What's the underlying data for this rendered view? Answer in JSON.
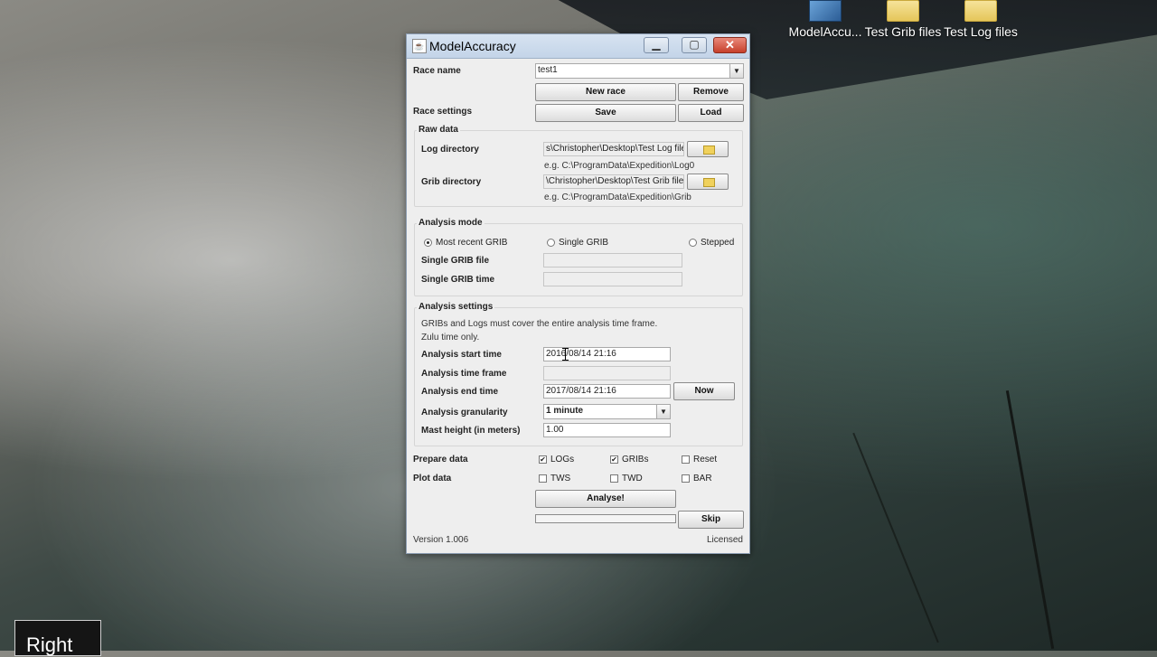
{
  "desktop": {
    "icons": [
      {
        "label": "ModelAccu...",
        "kind": "app"
      },
      {
        "label": "Test Grib files",
        "kind": "folder"
      },
      {
        "label": "Test Log files",
        "kind": "folder"
      }
    ],
    "corner_label": "Right"
  },
  "window": {
    "title": "ModelAccuracy",
    "controls": {
      "minimize": "▁",
      "maximize": "▢",
      "close": "✕"
    },
    "race": {
      "name_label": "Race name",
      "name_value": "test1",
      "new_race": "New race",
      "remove": "Remove",
      "settings_label": "Race settings",
      "save": "Save",
      "load": "Load"
    },
    "raw_data": {
      "title": "Raw data",
      "log_label": "Log directory",
      "log_value": "s\\Christopher\\Desktop\\Test Log files",
      "log_hint": "e.g. C:\\ProgramData\\Expedition\\Log0",
      "grib_label": "Grib directory",
      "grib_value": "\\Christopher\\Desktop\\Test Grib files",
      "grib_hint": "e.g. C:\\ProgramData\\Expedition\\Grib"
    },
    "analysis_mode": {
      "title": "Analysis mode",
      "options": [
        "Most recent GRIB",
        "Single GRIB",
        "Stepped"
      ],
      "selected": "Most recent GRIB",
      "single_file_label": "Single GRIB file",
      "single_time_label": "Single GRIB time"
    },
    "analysis_settings": {
      "title": "Analysis settings",
      "note1": "GRIBs and Logs must cover the entire analysis time frame.",
      "note2": "Zulu time only.",
      "start_label": "Analysis start time",
      "start_value": "2016/08/14 21:16",
      "timeframe_label": "Analysis time frame",
      "end_label": "Analysis end time",
      "end_value": "2017/08/14 21:16",
      "now": "Now",
      "granularity_label": "Analysis granularity",
      "granularity_value": "1 minute",
      "mast_label": "Mast height (in meters)",
      "mast_value": "1.00"
    },
    "prepare": {
      "label": "Prepare data",
      "items": [
        {
          "label": "LOGs",
          "checked": true
        },
        {
          "label": "GRIBs",
          "checked": true
        },
        {
          "label": "Reset",
          "checked": false
        }
      ]
    },
    "plot": {
      "label": "Plot data",
      "items": [
        {
          "label": "TWS",
          "checked": false
        },
        {
          "label": "TWD",
          "checked": false
        },
        {
          "label": "BAR",
          "checked": false
        }
      ]
    },
    "analyse": "Analyse!",
    "skip": "Skip",
    "progress": 0,
    "version": "Version 1.006",
    "license": "Licensed"
  }
}
